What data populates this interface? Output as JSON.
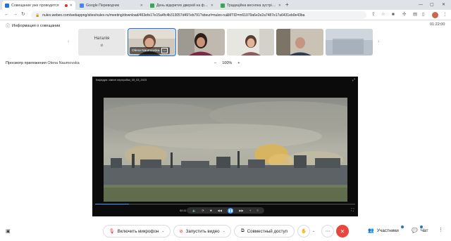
{
  "browser": {
    "tabs": [
      {
        "label": "Совещание уже проводится",
        "favicon_color": "#1a73e8",
        "recording": true,
        "active": true
      },
      {
        "label": "Google Переводчик",
        "favicon_color": "#4285f4",
        "recording": false,
        "active": false
      },
      {
        "label": "День відкритих дверей на фак...",
        "favicon_color": "#34a853",
        "recording": false,
        "active": false
      },
      {
        "label": "Традиційна весняна зустріч – Д...",
        "favicon_color": "#34a853",
        "recording": false,
        "active": false
      }
    ],
    "new_tab": "+",
    "address": "nulex.webex.com/webappng/sites/nulex-ru/meeting/download/463efe17e15a4fc4b313057d497eb791?siteurl=nulex-ru&MTID=m61079a6e2e2a7487e17a6431eb0e43ba"
  },
  "meeting": {
    "info_label": "Информация о совещании",
    "elapsed": "01:22:00",
    "participants": [
      {
        "name": "Наталія",
        "type": "name-only"
      },
      {
        "name": "Olena Naumovska",
        "type": "video",
        "active": true
      },
      {
        "name": "",
        "type": "video"
      },
      {
        "name": "",
        "type": "video"
      },
      {
        "name": "",
        "type": "video"
      },
      {
        "name": "",
        "type": "video"
      }
    ],
    "preview_label": "Просмотр приложения",
    "preview_owner": "Olena Naumovska",
    "zoom_minus": "−",
    "zoom_level": "100%",
    "zoom_plus": "+"
  },
  "shared": {
    "window_title": "Кафедра: хімічні переробки_05_03_2023",
    "time": "00:11",
    "progress_fraction": 0.13
  },
  "controls": {
    "mic_label": "Включить микрофон",
    "video_label": "Запустить видео",
    "share_label": "Совместный доступ",
    "participants_label": "Участники",
    "chat_label": "Чат"
  },
  "colors": {
    "accent": "#1a73e8",
    "leave": "#e8473d",
    "muted_red": "#d93025"
  }
}
